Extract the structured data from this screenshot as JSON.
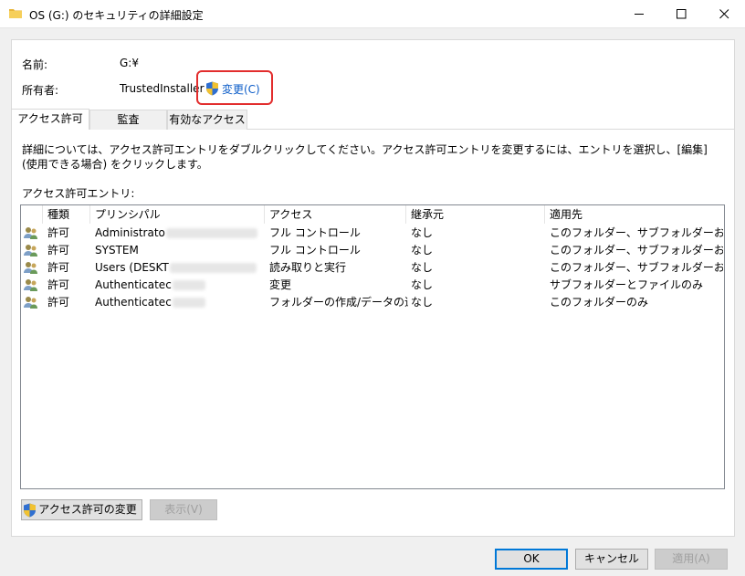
{
  "window": {
    "title": "OS (G:) のセキュリティの詳細設定"
  },
  "info": {
    "name_label": "名前:",
    "name_value": "G:¥",
    "owner_label": "所有者:",
    "owner_value": "TrustedInstaller",
    "change_link": "変更(C)"
  },
  "tabs": [
    {
      "label": "アクセス許可",
      "active": true
    },
    {
      "label": "監査",
      "active": false
    },
    {
      "label": "有効なアクセス",
      "active": false
    }
  ],
  "description": "詳細については、アクセス許可エントリをダブルクリックしてください。アクセス許可エントリを変更するには、エントリを選択し、[編集] (使用できる場合) をクリックします。",
  "entries_label": "アクセス許可エントリ:",
  "table": {
    "columns": [
      "種類",
      "プリンシパル",
      "アクセス",
      "継承元",
      "適用先"
    ],
    "rows": [
      {
        "type": "許可",
        "principal": "Administrato",
        "access": "フル コントロール",
        "inherited": "なし",
        "applies": "このフォルダー、サブフォルダーおよびファ..."
      },
      {
        "type": "許可",
        "principal": "SYSTEM",
        "access": "フル コントロール",
        "inherited": "なし",
        "applies": "このフォルダー、サブフォルダーおよびファ..."
      },
      {
        "type": "許可",
        "principal": "Users (DESKT",
        "access": "読み取りと実行",
        "inherited": "なし",
        "applies": "このフォルダー、サブフォルダーおよびファ..."
      },
      {
        "type": "許可",
        "principal": "Authenticatec",
        "access": "変更",
        "inherited": "なし",
        "applies": "サブフォルダーとファイルのみ"
      },
      {
        "type": "許可",
        "principal": "Authenticatec",
        "access": "フォルダーの作成/データの追加",
        "inherited": "なし",
        "applies": "このフォルダーのみ"
      }
    ]
  },
  "buttons": {
    "change_permissions": "アクセス許可の変更",
    "view": "表示(V)",
    "ok": "OK",
    "cancel": "キャンセル",
    "apply": "適用(A)"
  },
  "colors": {
    "highlight": "#e22d2d",
    "link": "#0b5cc8",
    "default_button_border": "#0078d7"
  }
}
